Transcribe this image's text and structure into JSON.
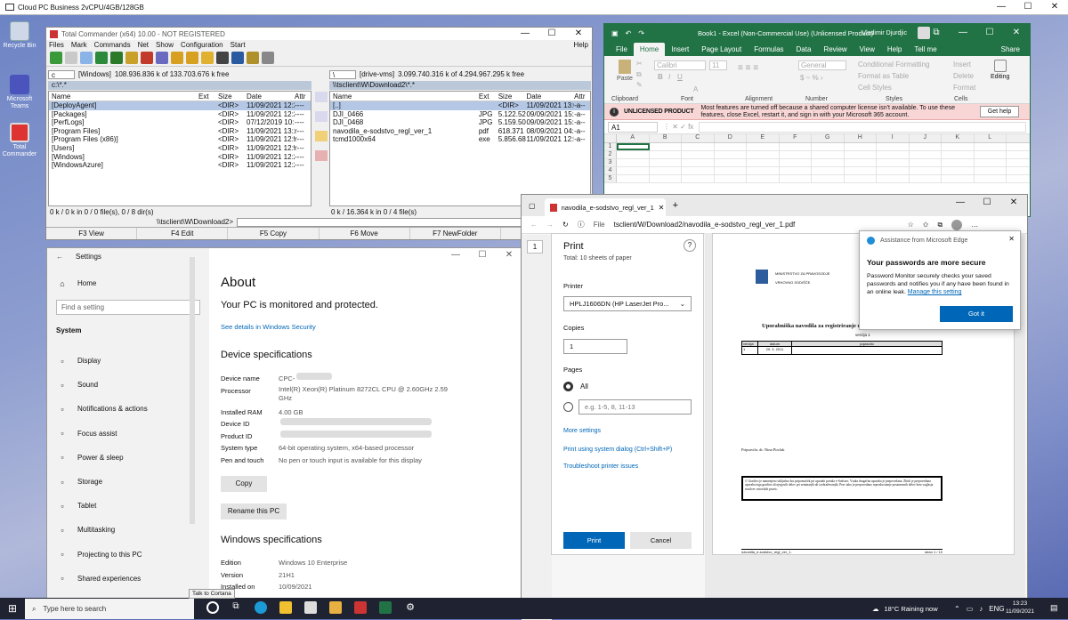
{
  "rdp": {
    "title": "Cloud PC Business 2vCPU/4GB/128GB"
  },
  "desktop": {
    "icons": [
      "Recycle Bin",
      "Microsoft Teams",
      "Total Commander"
    ]
  },
  "tc": {
    "title": "Total Commander (x64) 10.00 - NOT REGISTERED",
    "menu": [
      "Files",
      "Mark",
      "Commands",
      "Net",
      "Show",
      "Configuration",
      "Start"
    ],
    "help": "Help",
    "left": {
      "drive": "c",
      "label": "[Windows]",
      "free": "108.936.836 k of 133.703.676 k free",
      "path": "c:\\*.*",
      "headers": [
        "Name",
        "Ext",
        "Size",
        "Date",
        "Attr"
      ],
      "rows": [
        [
          "[DeployAgent]",
          "",
          "<DIR>",
          "11/09/2021 12:27",
          "----"
        ],
        [
          "[Packages]",
          "",
          "<DIR>",
          "11/09/2021 12:28",
          "----"
        ],
        [
          "[PerfLogs]",
          "",
          "<DIR>",
          "07/12/2019 10:14",
          "----"
        ],
        [
          "[Program Files]",
          "",
          "<DIR>",
          "11/09/2021 13:14",
          "r---"
        ],
        [
          "[Program Files (x86)]",
          "",
          "<DIR>",
          "11/09/2021 12:54",
          "r---"
        ],
        [
          "[Users]",
          "",
          "<DIR>",
          "11/09/2021 12:52",
          "r---"
        ],
        [
          "[Windows]",
          "",
          "<DIR>",
          "11/09/2021 12:24",
          "----"
        ],
        [
          "[WindowsAzure]",
          "",
          "<DIR>",
          "11/09/2021 12:29",
          "----"
        ]
      ],
      "status": "0 k / 0 k in 0 / 0 file(s), 0 / 8 dir(s)"
    },
    "right": {
      "drive": "\\",
      "label": "[drive-vms]",
      "free": "3.099.740.316 k of 4.294.967.295 k free",
      "path": "\\\\tsclient\\W\\Download2\\*.*",
      "headers": [
        "Name",
        "Ext",
        "Size",
        "Date",
        "Attr"
      ],
      "rows": [
        [
          "[..]",
          "",
          "<DIR>",
          "11/09/2021 13:08",
          "-a--"
        ],
        [
          "DJI_0466",
          "JPG",
          "5.122.526",
          "09/09/2021 15:53",
          "-a--"
        ],
        [
          "DJI_0468",
          "JPG",
          "5.159.509",
          "09/09/2021 15:53",
          "-a--"
        ],
        [
          "navodila_e-sodstvo_regl_ver_1",
          "pdf",
          "618.371",
          "08/09/2021 04:04",
          "-a--"
        ],
        [
          "tcmd1000x64",
          "exe",
          "5.856.680",
          "11/09/2021 12:59",
          "-a--"
        ]
      ],
      "status": "0 k / 16.364 k in 0 / 4 file(s)"
    },
    "cmdpath": "\\\\tsclient\\W\\Download2>",
    "fkeys": [
      "F3 View",
      "F4 Edit",
      "F5 Copy",
      "F6 Move",
      "F7 NewFolder",
      "F8 Delete"
    ]
  },
  "excel": {
    "title": "Book1 - Excel (Non-Commercial Use) (Unlicensed Product)",
    "user": "Vladimir Djurdjic",
    "tabs": [
      "File",
      "Home",
      "Insert",
      "Page Layout",
      "Formulas",
      "Data",
      "Review",
      "View",
      "Help",
      "Tell me",
      "Share"
    ],
    "groups": [
      "Clipboard",
      "Font",
      "Alignment",
      "Number",
      "Styles",
      "Cells",
      "Editing"
    ],
    "font_name": "Calibri",
    "font_size": "11",
    "number_format": "General",
    "styles": [
      "Conditional Formatting",
      "Format as Table",
      "Cell Styles"
    ],
    "cells": [
      "Insert",
      "Delete",
      "Format"
    ],
    "editing": "Editing",
    "paste": "Paste",
    "msg_badge": "UNLICENSED PRODUCT",
    "msg_text": "Most features are turned off because a shared computer license isn't available. To use these features, close Excel, restart it, and sign in with your Microsoft 365 account.",
    "get_help": "Get help",
    "namebox": "A1",
    "cols": [
      "A",
      "B",
      "C",
      "D",
      "E",
      "F",
      "G",
      "H",
      "I",
      "J",
      "K",
      "L"
    ],
    "rows": [
      "1",
      "2",
      "3",
      "4",
      "5"
    ]
  },
  "settings": {
    "title": "Settings",
    "home": "Home",
    "search_placeholder": "Find a setting",
    "section": "System",
    "nav": [
      [
        "Display",
        "monitor-icon"
      ],
      [
        "Sound",
        "speaker-icon"
      ],
      [
        "Notifications & actions",
        "notification-icon"
      ],
      [
        "Focus assist",
        "moon-icon"
      ],
      [
        "Power & sleep",
        "power-icon"
      ],
      [
        "Storage",
        "storage-icon"
      ],
      [
        "Tablet",
        "tablet-icon"
      ],
      [
        "Multitasking",
        "multitask-icon"
      ],
      [
        "Projecting to this PC",
        "project-icon"
      ],
      [
        "Shared experiences",
        "share-icon"
      ]
    ],
    "about": "About",
    "protected": "Your PC is monitored and protected.",
    "security_link": "See details in Windows Security",
    "device_spec": "Device specifications",
    "spec": [
      [
        "Device name",
        "CPC-"
      ],
      [
        "Processor",
        "Intel(R) Xeon(R) Platinum 8272CL CPU @ 2.60GHz 2.59 GHz"
      ],
      [
        "Installed RAM",
        "4.00 GB"
      ],
      [
        "Device ID",
        ""
      ],
      [
        "Product ID",
        ""
      ],
      [
        "System type",
        "64-bit operating system, x64-based processor"
      ],
      [
        "Pen and touch",
        "No pen or touch input is available for this display"
      ]
    ],
    "copy": "Copy",
    "rename": "Rename this PC",
    "win_spec": "Windows specifications",
    "wspec": [
      [
        "Edition",
        "Windows 10 Enterprise"
      ],
      [
        "Version",
        "21H1"
      ],
      [
        "Installed on",
        "10/09/2021"
      ]
    ]
  },
  "edge": {
    "tab": "navodila_e-sodstvo_regl_ver_1.p",
    "url_prefix": "File",
    "url": "tsclient/W/Download2/navodila_e-sodstvo_regl_ver_1.pdf",
    "page_num": "1"
  },
  "print": {
    "title": "Print",
    "total": "Total: 10 sheets of paper",
    "printer_label": "Printer",
    "printer": "HPLJ1606DN (HP LaserJet Pro...",
    "copies_label": "Copies",
    "copies": "1",
    "pages_label": "Pages",
    "all": "All",
    "range_placeholder": "e.g. 1-5, 8, 11-13",
    "more": "More settings",
    "system_dialog": "Print using system dialog (Ctrl+Shift+P)",
    "troubleshoot": "Troubleshoot printer issues",
    "print_btn": "Print",
    "cancel_btn": "Cancel"
  },
  "doc": {
    "header1": "MINISTRSTVO ZA PRAVOSODJE",
    "header2": "VRHOVNO SODIŠČE",
    "heading": "Uporabniška navodila za registriranje u",
    "version": "verzija 1",
    "table_head": [
      "verzija",
      "datum",
      "pojasnilo"
    ],
    "table_row": [
      "1",
      "29. 3. 2011",
      ""
    ],
    "author": "Pripravila: dr. Nina Pirclak",
    "box": "© Gradivo je namenjeno izključno kot pripomoček pri uporabi portala e-Sodstvo. Vsaka drugačna uporaba je prepovedana. Zbirk je prepovedana uporaba tega gradiva ali njegovih delov pri seminarjih ali izobraževanjih. Prav tako je prepovedano reproduciranje posameznih delov brez soglasja nosilcev avtorskih pravic.",
    "footer": "navodila_e-sodstvo_regl_ver_1.",
    "footer_page": "stran 1 / 10"
  },
  "popup": {
    "source": "Assistance from Microsoft Edge",
    "title": "Your passwords are more secure",
    "body": "Password Monitor securely checks your saved passwords and notifies you if any have been found in an online leak.",
    "link": "Manage this setting",
    "button": "Got it"
  },
  "taskbar": {
    "search": "Type here to search",
    "tooltip": "Talk to Cortana",
    "weather": "18°C  Raining now",
    "lang": "ENG",
    "time": "13:23",
    "date": "11/09/2021"
  }
}
